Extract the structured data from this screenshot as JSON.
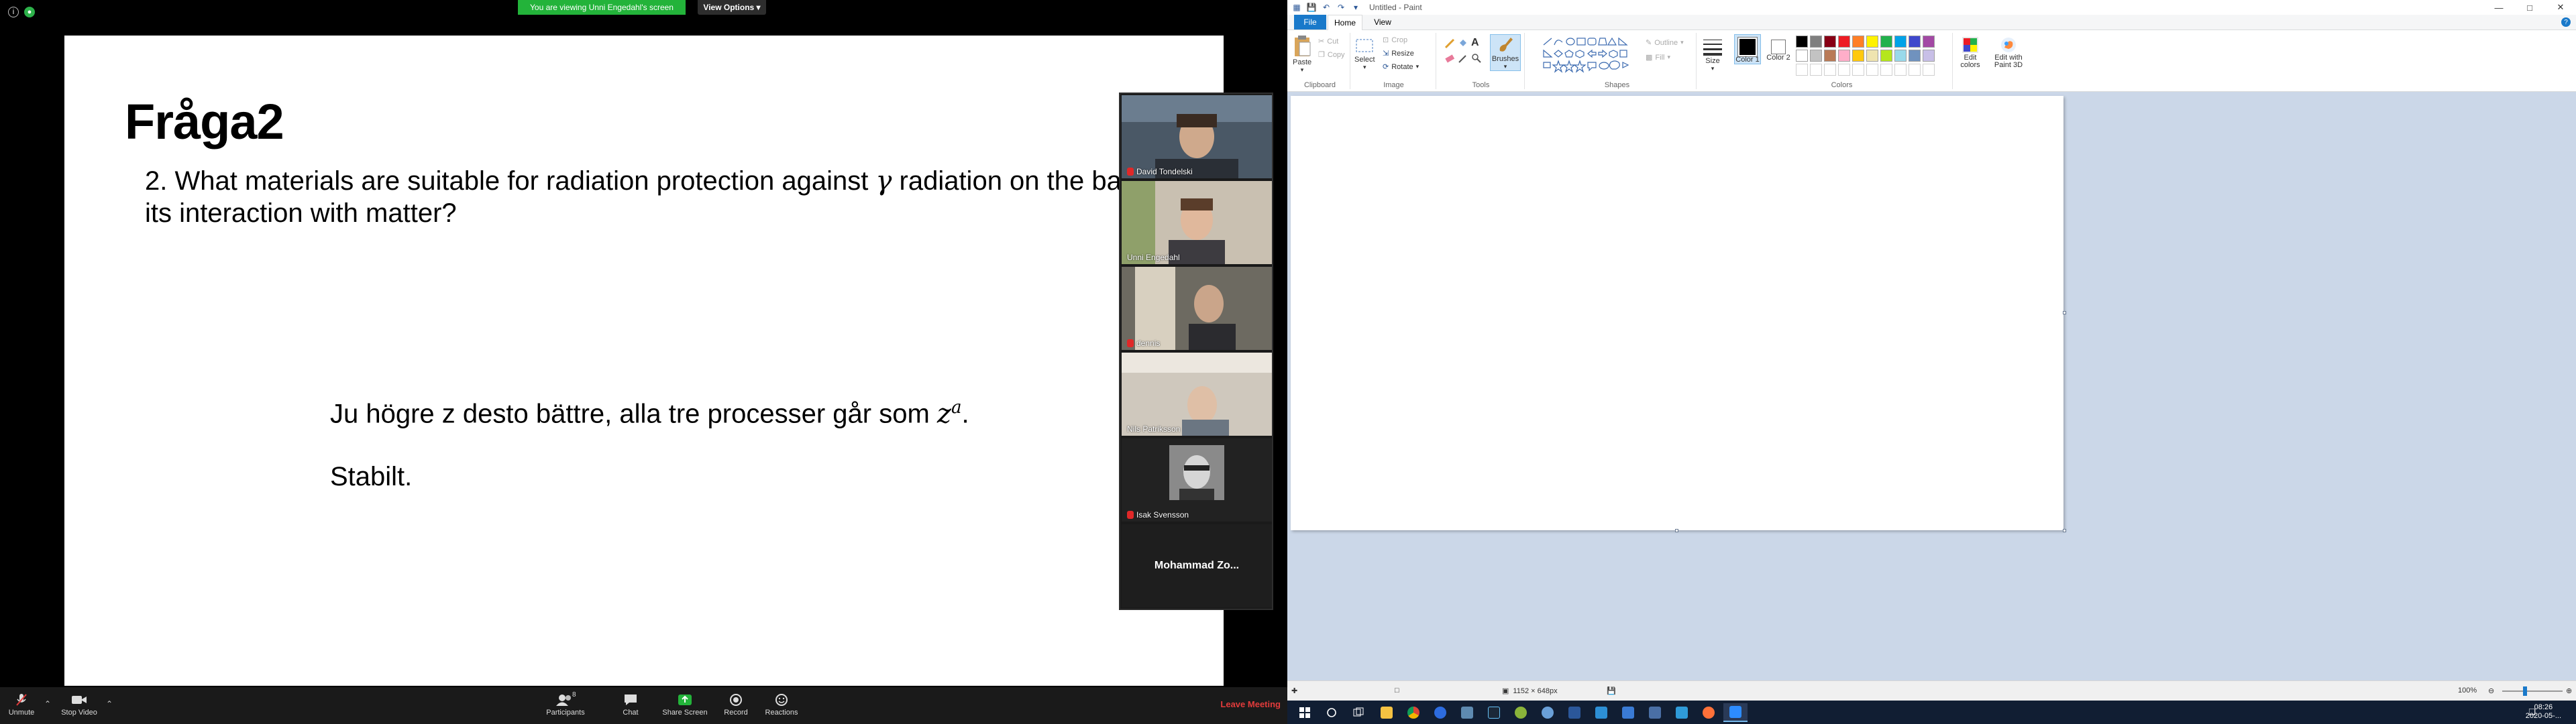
{
  "zoom": {
    "share_banner": "You are viewing Unni Engedahl's screen",
    "view_options": "View Options",
    "slide": {
      "title": "Fråga2",
      "question_text": "2. What materials are suitable for radiation protection against",
      "question_symbol": "γ",
      "question_text2": "radiation on the basis of its interaction with matter?",
      "answer_line1_text": "Ju högre z desto bättre, alla tre processer går som",
      "answer_line1_base": "z",
      "answer_line1_exp": "a",
      "answer_line1_end": ".",
      "answer_line2": "Stabilt."
    },
    "participants": [
      {
        "name": "David Tondelski",
        "muted": true
      },
      {
        "name": "Unni Engedahl",
        "muted": false
      },
      {
        "name": "dennis",
        "muted": true
      },
      {
        "name": "Nils Patriksson",
        "muted": false
      },
      {
        "name": "Isak Svensson",
        "muted": true
      },
      {
        "name": "Mohammad Zo...",
        "muted": false
      }
    ],
    "toolbar": {
      "unmute": "Unmute",
      "stop_video": "Stop Video",
      "participants": "Participants",
      "participants_count": "8",
      "chat": "Chat",
      "share_screen": "Share Screen",
      "record": "Record",
      "reactions": "Reactions",
      "leave": "Leave Meeting"
    }
  },
  "paint": {
    "title": "Untitled - Paint",
    "tabs": {
      "file": "File",
      "home": "Home",
      "view": "View"
    },
    "clipboard": {
      "paste": "Paste",
      "cut": "Cut",
      "copy": "Copy",
      "label": "Clipboard"
    },
    "image": {
      "select": "Select",
      "crop": "Crop",
      "resize": "Resize",
      "rotate": "Rotate",
      "label": "Image"
    },
    "tools": {
      "label": "Tools",
      "brushes": "Brushes"
    },
    "shapes": {
      "outline": "Outline",
      "fill": "Fill",
      "label": "Shapes"
    },
    "size": "Size",
    "color1": "Color 1",
    "color2": "Color 2",
    "colors_label": "Colors",
    "edit_colors": "Edit colors",
    "edit_3d": "Edit with Paint 3D",
    "palette_row1": [
      "#000000",
      "#7f7f7f",
      "#880015",
      "#ed1c24",
      "#ff7f27",
      "#fff200",
      "#22b14c",
      "#00a2e8",
      "#3f48cc",
      "#a349a4"
    ],
    "palette_row2": [
      "#ffffff",
      "#c3c3c3",
      "#b97a57",
      "#ffaec9",
      "#ffc90e",
      "#efe4b0",
      "#b5e61d",
      "#99d9ea",
      "#7092be",
      "#c8bfe7"
    ],
    "status": {
      "dimensions": "1152 × 648px",
      "zoom": "100%"
    }
  },
  "taskbar": {
    "time": "08:26",
    "date": "2020-05-..."
  }
}
